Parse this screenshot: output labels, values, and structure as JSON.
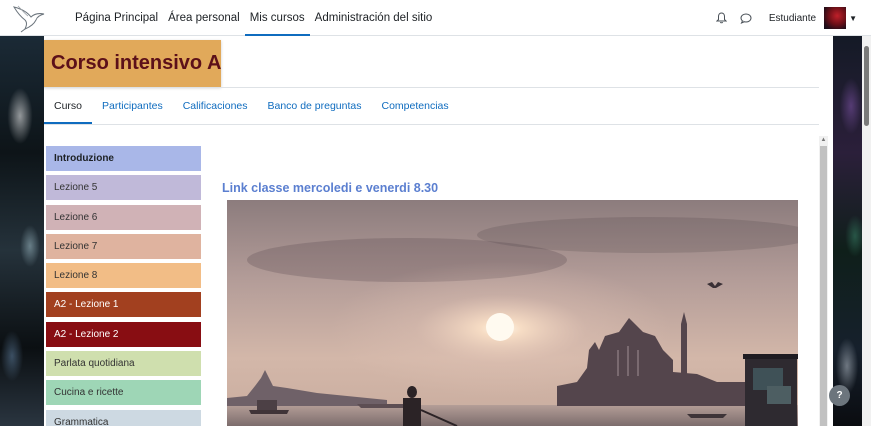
{
  "navbar": {
    "brand_icon": "hummingbird-logo",
    "links": [
      {
        "label": "Página Principal",
        "active": false
      },
      {
        "label": "Área personal",
        "active": false
      },
      {
        "label": "Mis cursos",
        "active": true
      },
      {
        "label": "Administración del sitio",
        "active": false
      }
    ],
    "notifications_icon": "bell-icon",
    "messages_icon": "chat-bubble-icon",
    "user_name": "Estudiante",
    "user_menu_icon": "chevron-down-icon"
  },
  "course": {
    "title": "Corso intensivo A",
    "title_bg": "#e1a95a",
    "title_color": "#5c1019"
  },
  "tabs": [
    {
      "label": "Curso",
      "active": true
    },
    {
      "label": "Participantes",
      "active": false
    },
    {
      "label": "Calificaciones",
      "active": false
    },
    {
      "label": "Banco de preguntas",
      "active": false
    },
    {
      "label": "Competencias",
      "active": false
    }
  ],
  "sections": [
    {
      "label": "Introduzione",
      "color": "#a9b7e8",
      "current": true
    },
    {
      "label": "Lezione 5",
      "color": "#c0b9d9"
    },
    {
      "label": "Lezione 6",
      "color": "#d0b2b6"
    },
    {
      "label": "Lezione 7",
      "color": "#dfb39f"
    },
    {
      "label": "Lezione 8",
      "color": "#f2bd86"
    },
    {
      "label": "A2 - Lezione 1",
      "color": "#a2401f",
      "dark": true
    },
    {
      "label": "A2 - Lezione 2",
      "color": "#880d12",
      "dark": true
    },
    {
      "label": "Parlata quotidiana",
      "color": "#cfdfae"
    },
    {
      "label": "Cucina e ricette",
      "color": "#9ed6b6"
    },
    {
      "label": "Grammatica",
      "color": "#cdd9e2"
    }
  ],
  "content": {
    "heading": "Link classe mercoledi e venerdi 8.30",
    "image_subject": "Venice lagoon at sunset with gondolier"
  },
  "help": {
    "label": "?"
  }
}
